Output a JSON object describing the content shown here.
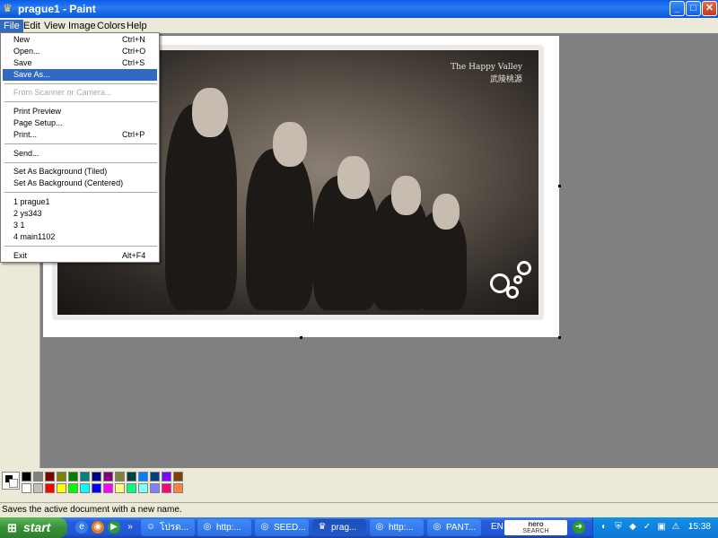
{
  "window": {
    "title": "prague1 - Paint",
    "buttons": {
      "minimize": "_",
      "maximize": "□",
      "close": "✕"
    }
  },
  "menubar": [
    "File",
    "Edit",
    "View",
    "Image",
    "Colors",
    "Help"
  ],
  "file_menu": {
    "items": [
      {
        "label": "New",
        "shortcut": "Ctrl+N"
      },
      {
        "label": "Open...",
        "shortcut": "Ctrl+O"
      },
      {
        "label": "Save",
        "shortcut": "Ctrl+S"
      },
      {
        "label": "Save As...",
        "shortcut": ""
      },
      {
        "label": "From Scanner or Camera...",
        "shortcut": ""
      },
      {
        "label": "Print Preview",
        "shortcut": ""
      },
      {
        "label": "Page Setup...",
        "shortcut": ""
      },
      {
        "label": "Print...",
        "shortcut": "Ctrl+P"
      },
      {
        "label": "Send...",
        "shortcut": ""
      },
      {
        "label": "Set As Background (Tiled)",
        "shortcut": ""
      },
      {
        "label": "Set As Background (Centered)",
        "shortcut": ""
      },
      {
        "label": "1 prague1",
        "shortcut": ""
      },
      {
        "label": "2 ys343",
        "shortcut": ""
      },
      {
        "label": "3 1",
        "shortcut": ""
      },
      {
        "label": "4 main1102",
        "shortcut": ""
      },
      {
        "label": "Exit",
        "shortcut": "Alt+F4"
      }
    ],
    "highlighted": "Save As...",
    "disabled": "From Scanner or Camera..."
  },
  "image": {
    "caption": "The Happy Valley",
    "caption_sub": "武陵桃源"
  },
  "palette": {
    "top_row": [
      "#000000",
      "#808080",
      "#800000",
      "#808000",
      "#008000",
      "#008080",
      "#000080",
      "#800080",
      "#808040",
      "#004040",
      "#0080ff",
      "#004080",
      "#8000ff",
      "#804000"
    ],
    "bottom_row": [
      "#ffffff",
      "#c0c0c0",
      "#ff0000",
      "#ffff00",
      "#00ff00",
      "#00ffff",
      "#0000ff",
      "#ff00ff",
      "#ffff80",
      "#00ff80",
      "#80ffff",
      "#8080ff",
      "#ff0080",
      "#ff8040"
    ]
  },
  "status": {
    "message": "Saves the active document with a new name."
  },
  "taskbar": {
    "start": "start",
    "tasks": [
      {
        "label": "โปรด...",
        "icon": "messenger-icon"
      },
      {
        "label": "http:...",
        "icon": "browser-icon"
      },
      {
        "label": "SEED...",
        "icon": "browser-icon"
      },
      {
        "label": "prag...",
        "icon": "paint-icon"
      },
      {
        "label": "http:...",
        "icon": "browser-icon"
      },
      {
        "label": "PANT...",
        "icon": "browser-icon"
      }
    ],
    "lang": "EN",
    "nero_line1": "nero",
    "nero_line2": "SEARCH",
    "clock": "15:38"
  }
}
